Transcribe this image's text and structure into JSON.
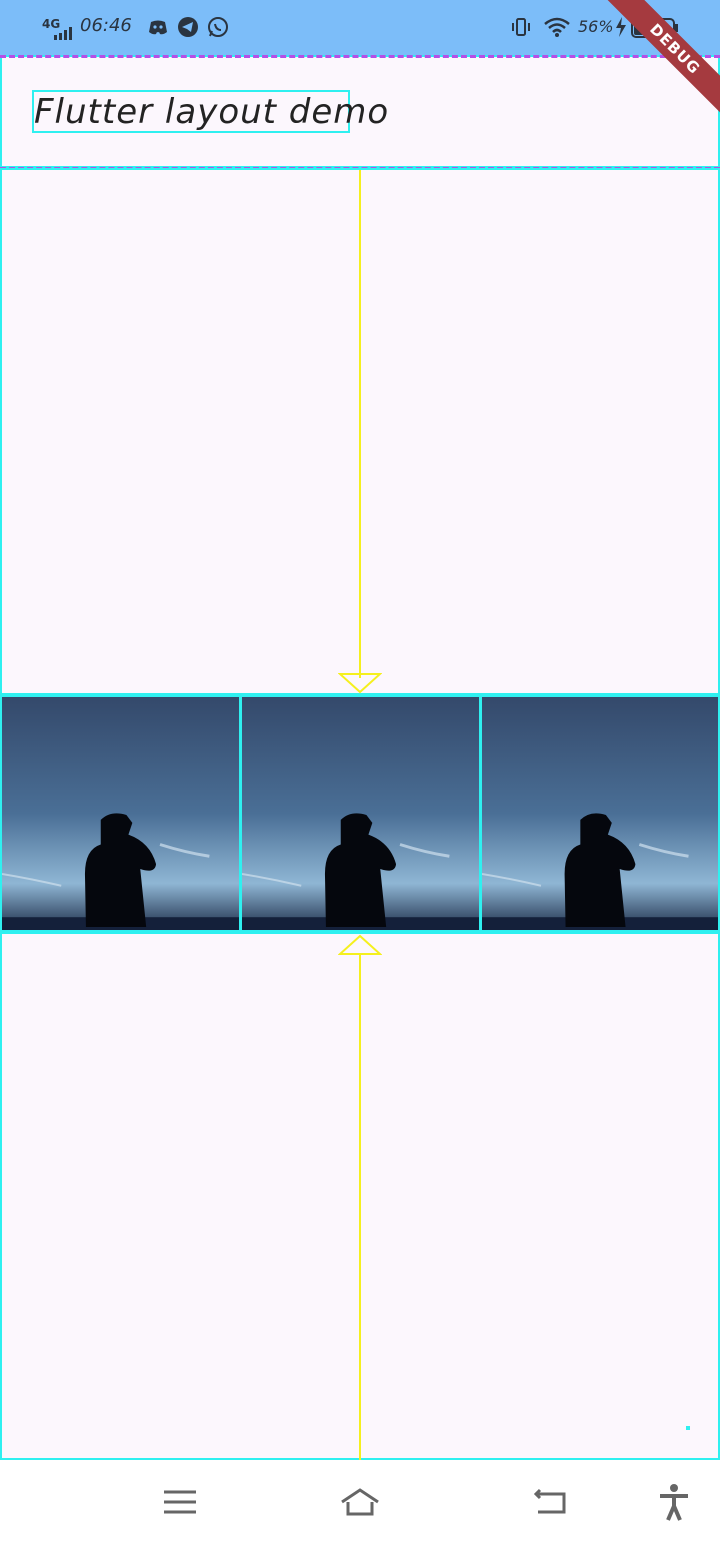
{
  "status_bar": {
    "network": "4G",
    "time": "06:46",
    "battery": "56%",
    "notification_icons": [
      "discord-icon",
      "telegram-icon",
      "whatsapp-icon"
    ],
    "status_icons": [
      "vibrate-icon",
      "wifi-icon",
      "charging-icon",
      "battery-icon"
    ]
  },
  "debug_banner": "DEBUG",
  "app_bar": {
    "title": "Flutter layout demo"
  },
  "gallery": {
    "images": [
      "photo-silhouette",
      "photo-silhouette",
      "photo-silhouette"
    ]
  },
  "nav_bar": {
    "buttons": [
      "menu-icon",
      "home-icon",
      "back-icon",
      "accessibility-icon"
    ]
  },
  "colors": {
    "status_bar": "#7cbdf9",
    "debug_banner": "#a53a3f",
    "guide_cyan": "#2ff0f0",
    "guide_yellow": "#f5f01e",
    "guide_purple": "#b54fe6",
    "background": "#fcf7fd"
  }
}
